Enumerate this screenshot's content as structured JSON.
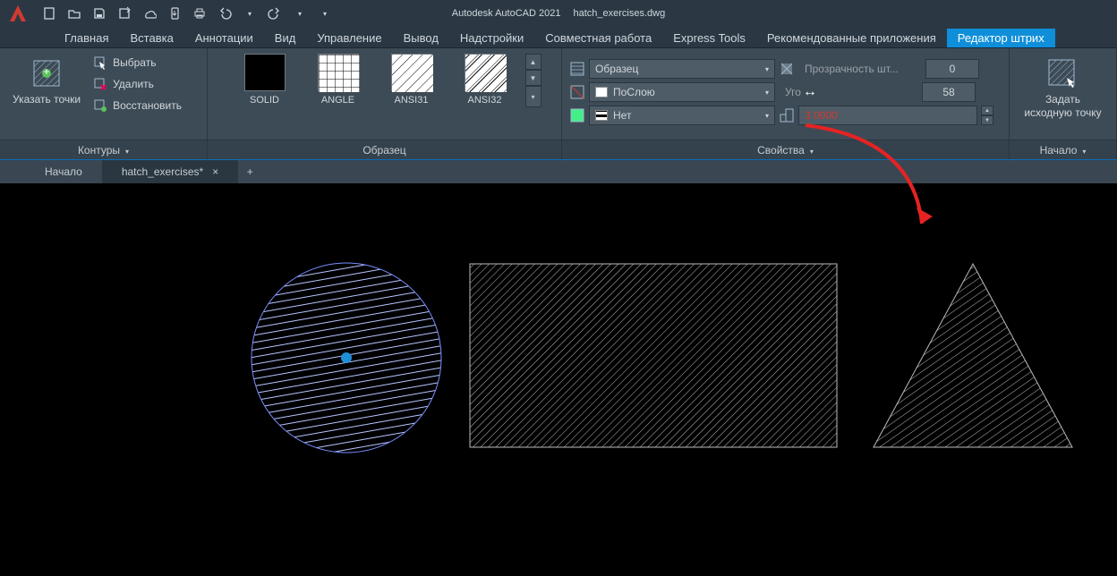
{
  "app": {
    "title": "Autodesk AutoCAD 2021",
    "filename": "hatch_exercises.dwg"
  },
  "menu_tabs": [
    "Главная",
    "Вставка",
    "Аннотации",
    "Вид",
    "Управление",
    "Вывод",
    "Надстройки",
    "Совместная работа",
    "Express Tools",
    "Рекомендованные приложения",
    "Редактор штрих"
  ],
  "menu_active_index": 10,
  "ribbon": {
    "boundaries": {
      "title": "Контуры",
      "pick_points": "Указать точки",
      "select": "Выбрать",
      "remove": "Удалить",
      "recreate": "Восстановить"
    },
    "pattern": {
      "title": "Образец",
      "items": [
        "SOLID",
        "ANGLE",
        "ANSI31",
        "ANSI32"
      ]
    },
    "properties": {
      "title": "Свойства",
      "pattern_mode": "Образец",
      "color_mode": "ПоСлою",
      "bg_mode": "Нет",
      "transparency_label": "Прозрачность шт...",
      "transparency_value": "0",
      "angle_label": "Уго",
      "angle_value": "58",
      "scale_value": "3.0000"
    },
    "origin": {
      "title": "Начало",
      "set_origin_line1": "Задать",
      "set_origin_line2": "исходную точку"
    }
  },
  "file_tabs": {
    "start": "Начало",
    "active": "hatch_exercises*"
  }
}
